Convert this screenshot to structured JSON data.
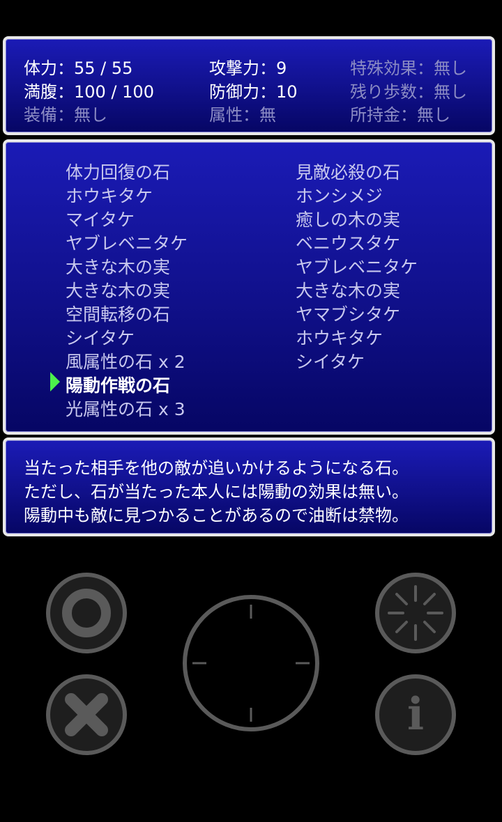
{
  "stats": {
    "hp": "体力：55 / 55",
    "attack": "攻撃力：9",
    "special": "特殊効果：無し",
    "fullness": "満腹：100 / 100",
    "defense": "防御力：10",
    "steps": "残り歩数：無し",
    "equipment": "装備：無し",
    "attribute": "属性：無",
    "money": "所持金：無し"
  },
  "inventory": {
    "left": [
      "体力回復の石",
      "ホウキタケ",
      "マイタケ",
      "ヤブレベニタケ",
      "大きな木の実",
      "大きな木の実",
      "空間転移の石",
      "シイタケ",
      "風属性の石 x 2",
      "陽動作戦の石",
      "光属性の石 x 3"
    ],
    "right": [
      "見敵必殺の石",
      "ホンシメジ",
      "癒しの木の実",
      "ベニウスタケ",
      "ヤブレベニタケ",
      "大きな木の実",
      "ヤマブシタケ",
      "ホウキタケ",
      "シイタケ"
    ],
    "selected": "陽動作戦の石"
  },
  "description": [
    "当たった相手を他の敵が追いかけるようになる石。",
    "ただし、石が当たった本人には陽動の効果は無い。",
    "陽動中も敵に見つかることがあるので油断は禁物。"
  ],
  "controls": {
    "confirm_icon": "circle-icon",
    "cancel_icon": "cross-icon",
    "dpad_icon": "direction-pad",
    "wait_icon": "sparkle-icon",
    "info_icon": "info-icon",
    "info_glyph": "i"
  },
  "colors": {
    "panel_top": "#1b1bb6",
    "panel_bottom": "#060664",
    "cursor": "#4cf04c",
    "button": "#5a5a5a"
  }
}
